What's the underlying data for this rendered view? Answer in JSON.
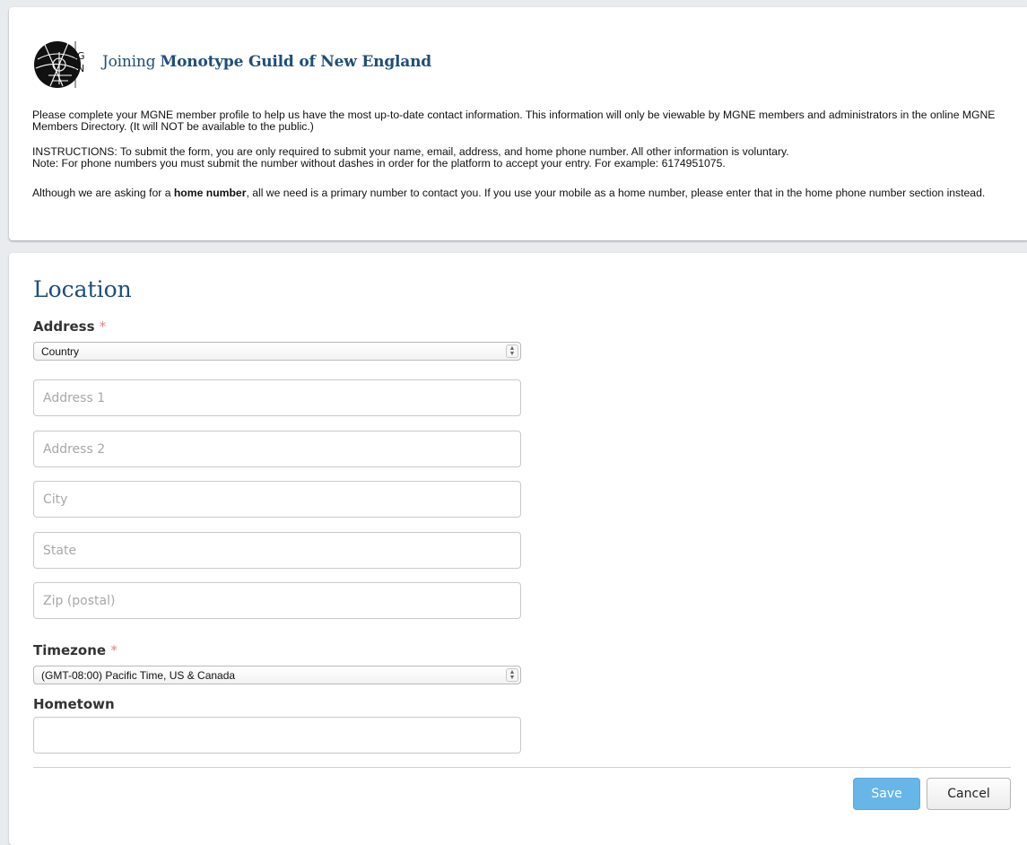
{
  "header": {
    "title_prefix": "Joining",
    "org_name": "Monotype Guild of New England",
    "logo_letters": [
      "G",
      "N"
    ]
  },
  "intro": {
    "p1": "Please complete your MGNE member profile to help us have the most up-to-date contact information. This information will only be viewable by MGNE members and administrators in the online MGNE Members Directory. (It will NOT be available to the public.)",
    "p2_line1": "INSTRUCTIONS: To submit the form, you are only required to submit your name, email, address, and home phone number. All other information is voluntary.",
    "p2_line2": "Note: For phone numbers you must submit the number without dashes in order for the platform to accept your entry. For example: 6174951075.",
    "p3_before": "Although we are asking for a ",
    "p3_bold": "home number",
    "p3_after": ", all we need is a primary number to contact you. If you use your mobile as a home number, please enter that in the home phone number section instead."
  },
  "location": {
    "section_title": "Location",
    "address_label": "Address",
    "required_marker": "*",
    "country_selected": "Country",
    "address1_placeholder": "Address 1",
    "address2_placeholder": "Address 2",
    "city_placeholder": "City",
    "state_placeholder": "State",
    "zip_placeholder": "Zip (postal)",
    "timezone_label": "Timezone",
    "timezone_selected": "(GMT-08:00) Pacific Time, US & Canada",
    "hometown_label": "Hometown",
    "hometown_value": ""
  },
  "actions": {
    "save_label": "Save",
    "cancel_label": "Cancel"
  },
  "colors": {
    "heading_blue": "#1f4e79",
    "save_button": "#68b6e8",
    "required_red": "#e67e7e",
    "page_background": "#e9ecef"
  }
}
